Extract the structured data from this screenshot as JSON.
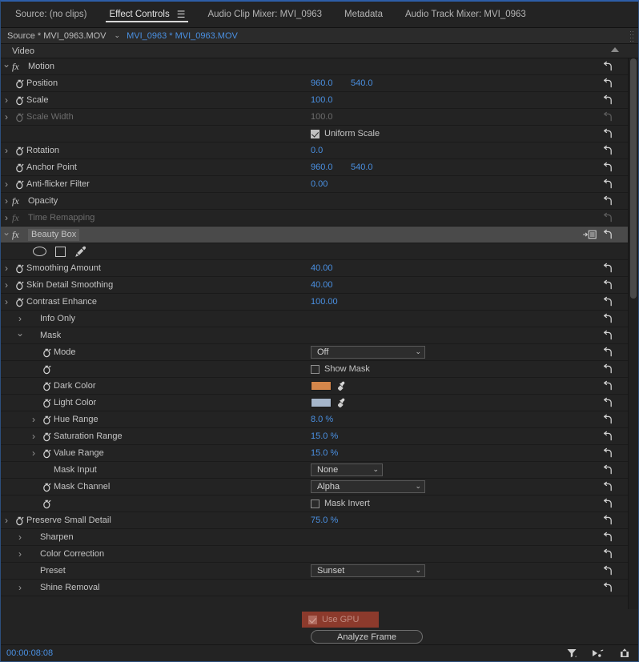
{
  "panel_tabs": [
    {
      "label": "Source: (no clips)",
      "active": false,
      "menu": false
    },
    {
      "label": "Effect Controls",
      "active": true,
      "menu": true
    },
    {
      "label": "Audio Clip Mixer: MVI_0963",
      "active": false,
      "menu": false
    },
    {
      "label": "Metadata",
      "active": false,
      "menu": false
    },
    {
      "label": "Audio Track Mixer: MVI_0963",
      "active": false,
      "menu": false
    }
  ],
  "menu_glyph": "☰",
  "clipbar": {
    "source_label": "Source * MVI_0963.MOV",
    "caret": "⌄",
    "clip_label": "MVI_0963 * MVI_0963.MOV"
  },
  "video_header": {
    "label": "Video"
  },
  "rows": [
    {
      "id": "motion",
      "type": "effect",
      "label": "Motion",
      "twisty": "open",
      "fx": true,
      "reset": true,
      "indent": 0
    },
    {
      "id": "position",
      "type": "prop",
      "label": "Position",
      "twisty": "blank",
      "stopwatch": true,
      "v1": "960.0",
      "v2": "540.0",
      "reset": true
    },
    {
      "id": "scale",
      "type": "prop",
      "label": "Scale",
      "twisty": "closed",
      "stopwatch": true,
      "v1": "100.0",
      "reset": true
    },
    {
      "id": "scale-width",
      "type": "prop",
      "label": "Scale Width",
      "twisty": "closed",
      "stopwatch": true,
      "v1": "100.0",
      "dim": true,
      "reset": true
    },
    {
      "id": "uniform-scale",
      "type": "check",
      "label": "",
      "twisty": "blank",
      "check_label": "Uniform Scale",
      "checked": true,
      "reset": true
    },
    {
      "id": "rotation",
      "type": "prop",
      "label": "Rotation",
      "twisty": "closed",
      "stopwatch": true,
      "v1": "0.0",
      "reset": true
    },
    {
      "id": "anchor-point",
      "type": "prop",
      "label": "Anchor Point",
      "twisty": "blank",
      "stopwatch": true,
      "v1": "960.0",
      "v2": "540.0",
      "reset": true
    },
    {
      "id": "anti-flicker-filter",
      "type": "prop",
      "label": "Anti-flicker Filter",
      "twisty": "closed",
      "stopwatch": true,
      "v1": "0.00",
      "reset": true
    },
    {
      "id": "opacity",
      "type": "effect",
      "label": "Opacity",
      "twisty": "closed",
      "fx": true,
      "reset": true
    },
    {
      "id": "time-remapping",
      "type": "effect",
      "label": "Time Remapping",
      "twisty": "closed",
      "fx": true,
      "dim": true,
      "reset": false
    },
    {
      "id": "beauty-box",
      "type": "effect",
      "label": "Beauty Box",
      "twisty": "open",
      "fx": true,
      "selected": true,
      "reset": true,
      "fxicon": true
    },
    {
      "id": "shape-tools",
      "type": "shapes",
      "label": ""
    },
    {
      "id": "smoothing-amount",
      "type": "prop",
      "label": "Smoothing Amount",
      "twisty": "closed",
      "stopwatch": true,
      "v1": "40.00",
      "reset": true
    },
    {
      "id": "skin-detail-smoothing",
      "type": "prop",
      "label": "Skin Detail Smoothing",
      "twisty": "closed",
      "stopwatch": true,
      "v1": "40.00",
      "reset": true
    },
    {
      "id": "contrast-enhance",
      "type": "prop",
      "label": "Contrast Enhance",
      "twisty": "closed",
      "stopwatch": true,
      "v1": "100.00",
      "reset": true
    },
    {
      "id": "info-only",
      "type": "group",
      "label": "Info Only",
      "twisty": "closed",
      "indent": 1
    },
    {
      "id": "mask",
      "type": "group",
      "label": "Mask",
      "twisty": "open",
      "indent": 1
    },
    {
      "id": "mode",
      "type": "dropdown",
      "label": "Mode",
      "twisty": "blank",
      "stopwatch": true,
      "dd_value": "Off",
      "dd_width": "wide",
      "indent": 2,
      "reset": true
    },
    {
      "id": "show-mask",
      "type": "check",
      "label": "",
      "twisty": "blank",
      "stopwatch": true,
      "check_label": "Show Mask",
      "checked": false,
      "indent": 2,
      "reset": true
    },
    {
      "id": "dark-color",
      "type": "color",
      "label": "Dark Color",
      "twisty": "blank",
      "stopwatch": true,
      "color": "#d4864a",
      "indent": 2,
      "reset": true
    },
    {
      "id": "light-color",
      "type": "color",
      "label": "Light Color",
      "twisty": "blank",
      "stopwatch": true,
      "color": "#a6b6cb",
      "indent": 2,
      "reset": true
    },
    {
      "id": "hue-range",
      "type": "prop",
      "label": "Hue Range",
      "twisty": "closed",
      "stopwatch": true,
      "v1": "8.0 %",
      "indent": 2,
      "reset": true
    },
    {
      "id": "saturation-range",
      "type": "prop",
      "label": "Saturation Range",
      "twisty": "closed",
      "stopwatch": true,
      "v1": "15.0 %",
      "indent": 2,
      "reset": true
    },
    {
      "id": "value-range",
      "type": "prop",
      "label": "Value Range",
      "twisty": "closed",
      "stopwatch": true,
      "v1": "15.0 %",
      "indent": 2,
      "reset": true
    },
    {
      "id": "mask-input",
      "type": "dropdown",
      "label": "Mask Input",
      "twisty": "blank",
      "dd_value": "None",
      "dd_width": "narrow",
      "indent": 2,
      "reset": true
    },
    {
      "id": "mask-channel",
      "type": "dropdown",
      "label": "Mask Channel",
      "twisty": "blank",
      "stopwatch": true,
      "dd_value": "Alpha",
      "dd_width": "wide",
      "indent": 2,
      "reset": true
    },
    {
      "id": "mask-invert",
      "type": "check",
      "label": "",
      "twisty": "blank",
      "stopwatch": true,
      "check_label": "Mask Invert",
      "checked": false,
      "indent": 2,
      "reset": true
    },
    {
      "id": "preserve-small-detail",
      "type": "prop",
      "label": "Preserve Small Detail",
      "twisty": "closed",
      "stopwatch": true,
      "v1": "75.0 %",
      "reset": true
    },
    {
      "id": "sharpen",
      "type": "group",
      "label": "Sharpen",
      "twisty": "closed",
      "indent": 1
    },
    {
      "id": "color-correction",
      "type": "group",
      "label": "Color Correction",
      "twisty": "closed",
      "indent": 1
    },
    {
      "id": "preset",
      "type": "dropdown",
      "label": "Preset",
      "twisty": "blank",
      "dd_value": "Sunset",
      "dd_width": "wide",
      "indent": 1,
      "reset": true
    },
    {
      "id": "shine-removal",
      "type": "group",
      "label": "Shine Removal",
      "twisty": "closed",
      "indent": 1
    }
  ],
  "buttons": {
    "use_gpu_label": "Use GPU",
    "use_gpu_checked": true,
    "analyze_frame_label": "Analyze Frame"
  },
  "statusbar": {
    "timecode": "00:00:08:08",
    "icons": [
      "filter-icon",
      "play-audio-icon",
      "export-icon"
    ]
  },
  "colors": {
    "accent_blue": "#4a90e2",
    "panel_bg": "#232323",
    "row_selected": "#4a4a4a",
    "gpu_button": "#8c3a2c",
    "dark_color_swatch": "#d4864a",
    "light_color_swatch": "#a6b6cb"
  }
}
